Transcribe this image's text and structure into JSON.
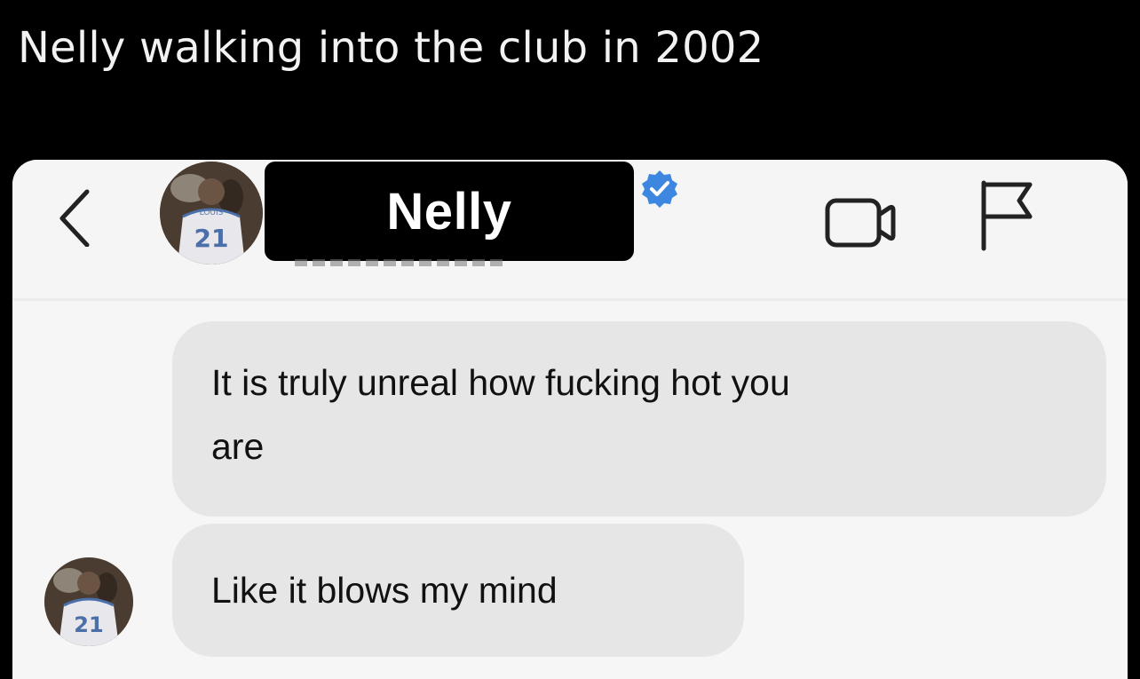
{
  "caption": "Nelly walking into the club in 2002",
  "header": {
    "contact_name": "Nelly",
    "verified": true,
    "back_icon": "chevron-left-icon",
    "video_icon": "video-camera-icon",
    "report_icon": "flag-icon",
    "avatar_jersey_number": "21"
  },
  "messages": [
    {
      "text_line_1": "It is truly unreal how fucking hot you",
      "text_line_2": "are"
    },
    {
      "text_line_1": "Like it blows my mind"
    }
  ],
  "message_avatar_jersey_number": "21",
  "colors": {
    "background": "#000000",
    "caption_text": "#f2f2f2",
    "chat_background": "#f6f6f6",
    "bubble": "#e6e6e6",
    "verified_badge": "#3d87e0",
    "name_box": "#000000"
  }
}
